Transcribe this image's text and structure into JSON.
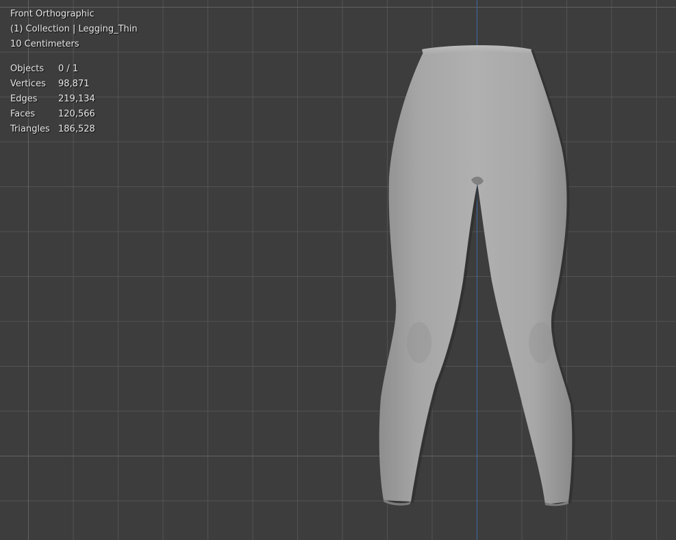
{
  "viewport": {
    "view_name": "Front Orthographic",
    "collection_info": "(1) Collection | Legging_Thin",
    "grid_scale": "10 Centimeters",
    "object_name": "Legging_Thin",
    "axis_color": "#3f6aa6",
    "background_color": "#3d3d3d",
    "mesh_color": "#a9a9a9"
  },
  "stats": [
    {
      "label": "Objects",
      "value": "0 / 1"
    },
    {
      "label": "Vertices",
      "value": "98,871"
    },
    {
      "label": "Edges",
      "value": "219,134"
    },
    {
      "label": "Faces",
      "value": "120,566"
    },
    {
      "label": "Triangles",
      "value": "186,528"
    }
  ]
}
